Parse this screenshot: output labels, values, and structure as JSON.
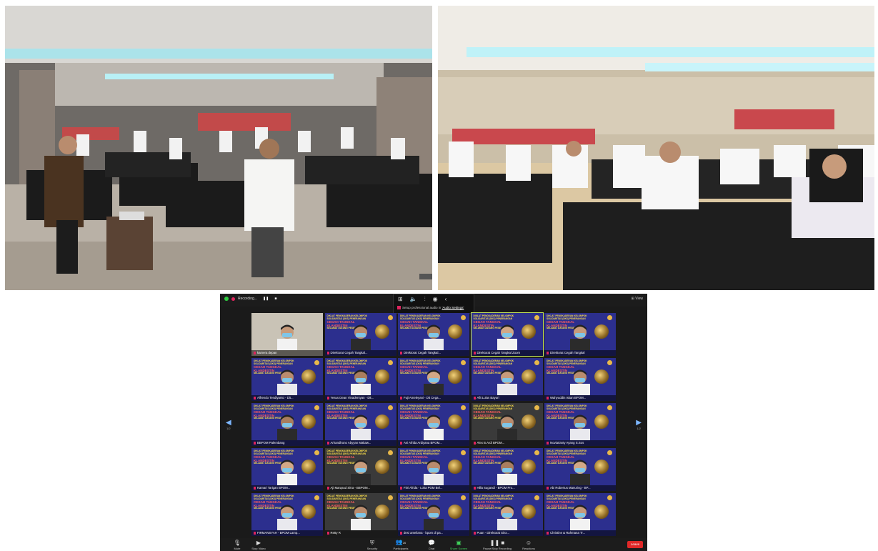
{
  "zoom": {
    "recording_label": "Recording...",
    "view_label": "View",
    "audio_msg_prefix": "Setup professional audio in",
    "audio_msg_link": "'Audio Settings'",
    "banner": {
      "line1": "DIKLAT PENGKADERAN KELOMPOK SOLIDARITAS (DKS) PENERANGAN",
      "line2": "CEGAH TANGKAL KLANDESTIN",
      "line3": "SELAMAT DATANG PESERTA"
    },
    "page_left": "1/2",
    "page_right": "1/2",
    "tiles": [
      {
        "name": "kamera depan"
      },
      {
        "name": "Direktorat Cegah Tangkal..."
      },
      {
        "name": "Direktorat Cegah Tangkal..."
      },
      {
        "name": "Direktorat Cegah Tangkal Zoom"
      },
      {
        "name": "Direktorat Cegah Tangkal"
      },
      {
        "name": "Alfrendo Tendiyanto - Dit..."
      },
      {
        "name": "Yesus Dean Vinadersyan - Dit..."
      },
      {
        "name": "Fuji Ameleyani - Dit Cega..."
      },
      {
        "name": "Afit Lulus Bayuri"
      },
      {
        "name": "Wahyuddin Iskan BPOM..."
      },
      {
        "name": "BBPOM Palembang"
      },
      {
        "name": "Arhandhono Abyyan Makaw..."
      },
      {
        "name": "Ani Afrida Ardiyana BPOM..."
      },
      {
        "name": "Alex B.Ardi BPOM..."
      },
      {
        "name": "Noviarianty Ayang S.Sos"
      },
      {
        "name": "Kamari Tarigan BPOM..."
      },
      {
        "name": "Aji Marqsud Sitra - BBPOM..."
      },
      {
        "name": "Fitri Afrida - Loka POM Bel..."
      },
      {
        "name": "Hilla Sugandi - BPOM Pro..."
      },
      {
        "name": "Abi Robertus Manuring - BP..."
      },
      {
        "name": "FIRMANSYAH - BPOM Lamp..."
      },
      {
        "name": "Retty R"
      },
      {
        "name": "desi ameliana - bpom di pa..."
      },
      {
        "name": "Puan - Direktorat Sinx..."
      },
      {
        "name": "Christine & Rahmana Tr..."
      }
    ],
    "toolbar": {
      "mute": "Mute",
      "stop_video": "Stop Video",
      "security": "Security",
      "participants": "Participants",
      "participants_count": "26",
      "chat": "Chat",
      "share_screen": "Share Screen",
      "pause_recording": "Pause/Stop Recording",
      "reactions": "Reactions",
      "leave": "Leave"
    }
  }
}
